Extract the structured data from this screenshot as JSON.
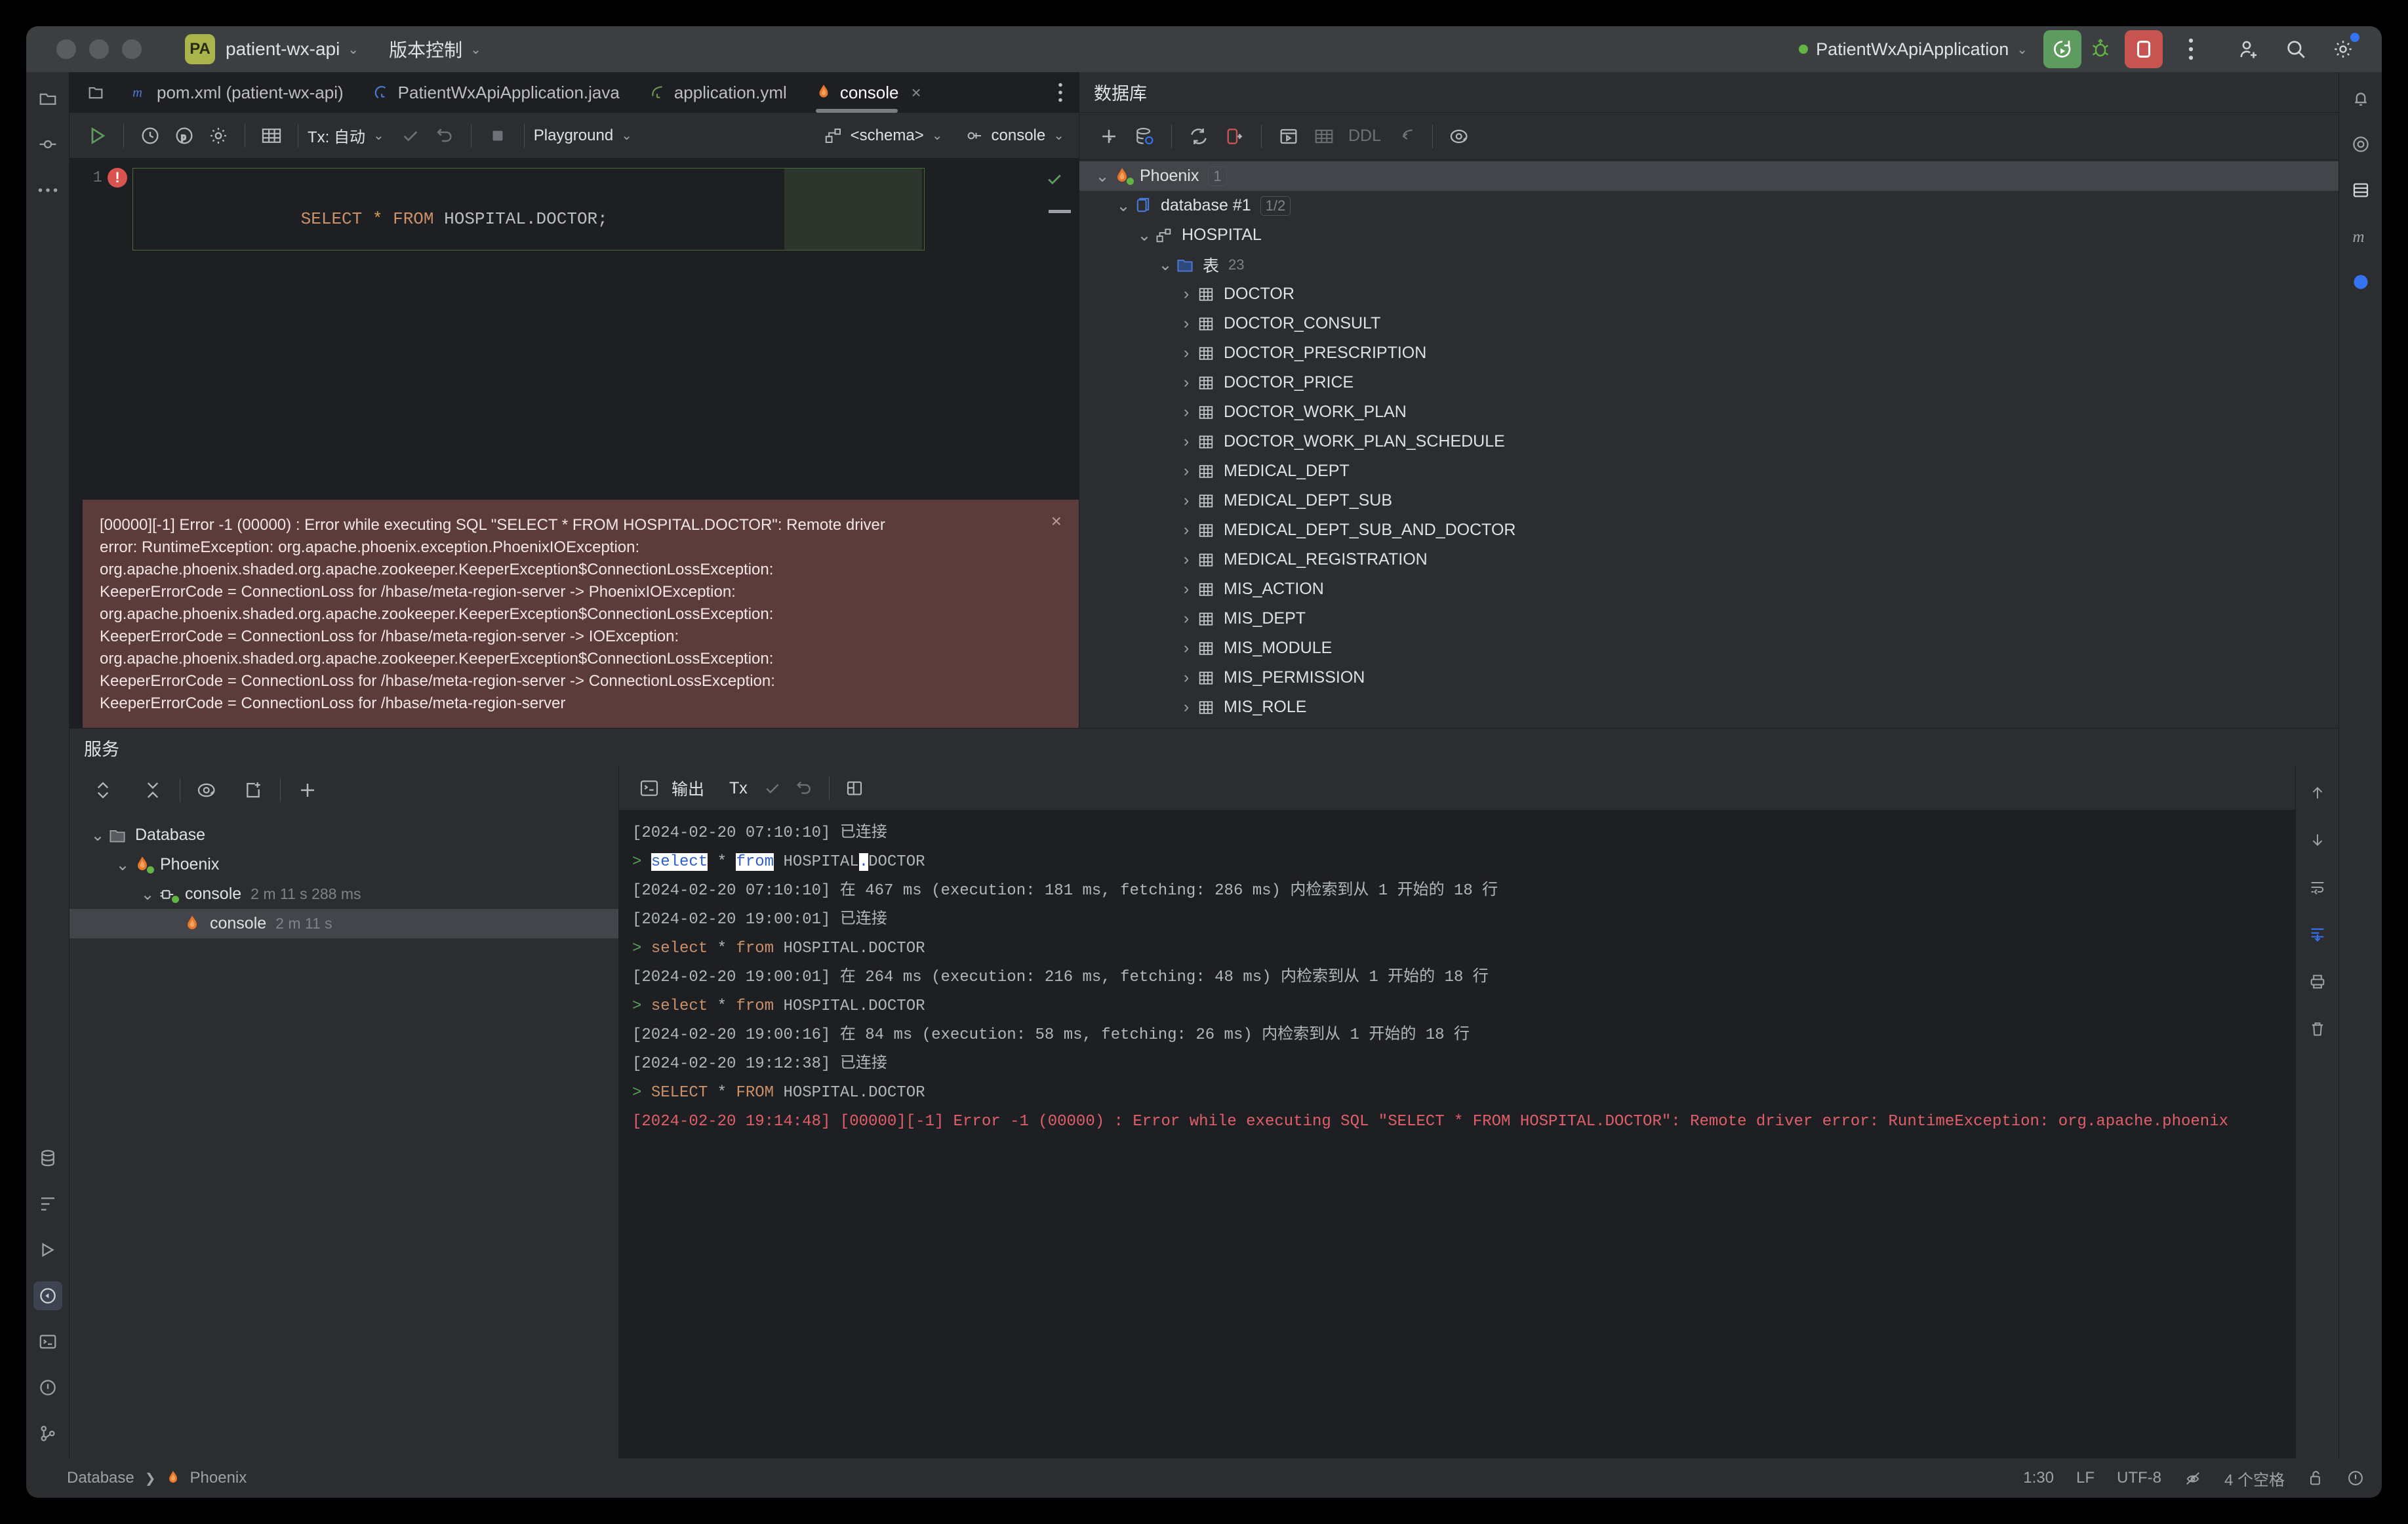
{
  "titlebar": {
    "project_badge": "PA",
    "project_name": "patient-wx-api",
    "vcs_label": "版本控制",
    "run_config": "PatientWxApiApplication",
    "chevron": "⌄"
  },
  "editor_tabs": [
    {
      "label": "pom.xml (patient-wx-api)",
      "icon": "maven-m-icon",
      "active": false
    },
    {
      "label": "PatientWxApiApplication.java",
      "icon": "spring-boot-icon",
      "active": false
    },
    {
      "label": "application.yml",
      "icon": "spring-leaf-icon",
      "active": false
    },
    {
      "label": "console",
      "icon": "phoenix-flame-icon",
      "active": true,
      "closable": true
    }
  ],
  "sql_toolbar": {
    "run_label": "run-icon",
    "tx_label": "Tx: 自动",
    "playground_label": "Playground",
    "schema_label": "<schema>",
    "session_label": "console",
    "chevron": "⌄"
  },
  "editor": {
    "line_number": "1",
    "code_tokens": [
      {
        "text": "SELECT",
        "cls": "kw"
      },
      {
        "text": " ",
        "cls": "id"
      },
      {
        "text": "*",
        "cls": "op"
      },
      {
        "text": " ",
        "cls": "id"
      },
      {
        "text": "FROM",
        "cls": "kw"
      },
      {
        "text": " HOSPITAL.DOCTOR;",
        "cls": "id"
      }
    ],
    "code_plain": "SELECT * FROM HOSPITAL.DOCTOR;"
  },
  "error_panel": {
    "close": "×",
    "lines": [
      "[00000][-1] Error -1 (00000) : Error while executing SQL \"SELECT * FROM HOSPITAL.DOCTOR\": Remote driver",
      "error: RuntimeException: org.apache.phoenix.exception.PhoenixIOException:",
      "org.apache.phoenix.shaded.org.apache.zookeeper.KeeperException$ConnectionLossException:",
      "KeeperErrorCode = ConnectionLoss for /hbase/meta-region-server -> PhoenixIOException:",
      "org.apache.phoenix.shaded.org.apache.zookeeper.KeeperException$ConnectionLossException:",
      "KeeperErrorCode = ConnectionLoss for /hbase/meta-region-server -> IOException:",
      "org.apache.phoenix.shaded.org.apache.zookeeper.KeeperException$ConnectionLossException:",
      "KeeperErrorCode = ConnectionLoss for /hbase/meta-region-server -> ConnectionLossException:",
      "KeeperErrorCode = ConnectionLoss for /hbase/meta-region-server"
    ]
  },
  "database_panel": {
    "title": "数据库",
    "toolbar_icons": [
      "plus-icon",
      "database-refresh-icon",
      "sync-icon",
      "stop-session-icon",
      "open-console-icon",
      "table-editor-icon",
      "ddl-icon",
      "jump-to-editor-icon",
      "eye-icon"
    ],
    "ddl_label": "DDL",
    "tree": [
      {
        "label": "Phoenix",
        "badge": "1",
        "depth": 0,
        "arrow": "⌄",
        "icon": "phoenix-flame-icon",
        "selected": true
      },
      {
        "label": "database #1",
        "badge": "1/2",
        "depth": 1,
        "arrow": "⌄",
        "icon": "database-icon",
        "selected": false
      },
      {
        "label": "HOSPITAL",
        "badge": "",
        "depth": 2,
        "arrow": "⌄",
        "icon": "schema-icon",
        "selected": false
      },
      {
        "label": "表",
        "badge": "23",
        "depth": 3,
        "arrow": "⌄",
        "icon": "folder-icon",
        "selected": false,
        "badge_plain": true
      },
      {
        "label": "DOCTOR",
        "badge": "",
        "depth": 4,
        "arrow": "›",
        "icon": "table-icon",
        "selected": false
      },
      {
        "label": "DOCTOR_CONSULT",
        "badge": "",
        "depth": 4,
        "arrow": "›",
        "icon": "table-icon",
        "selected": false
      },
      {
        "label": "DOCTOR_PRESCRIPTION",
        "badge": "",
        "depth": 4,
        "arrow": "›",
        "icon": "table-icon",
        "selected": false
      },
      {
        "label": "DOCTOR_PRICE",
        "badge": "",
        "depth": 4,
        "arrow": "›",
        "icon": "table-icon",
        "selected": false
      },
      {
        "label": "DOCTOR_WORK_PLAN",
        "badge": "",
        "depth": 4,
        "arrow": "›",
        "icon": "table-icon",
        "selected": false
      },
      {
        "label": "DOCTOR_WORK_PLAN_SCHEDULE",
        "badge": "",
        "depth": 4,
        "arrow": "›",
        "icon": "table-icon",
        "selected": false
      },
      {
        "label": "MEDICAL_DEPT",
        "badge": "",
        "depth": 4,
        "arrow": "›",
        "icon": "table-icon",
        "selected": false
      },
      {
        "label": "MEDICAL_DEPT_SUB",
        "badge": "",
        "depth": 4,
        "arrow": "›",
        "icon": "table-icon",
        "selected": false
      },
      {
        "label": "MEDICAL_DEPT_SUB_AND_DOCTOR",
        "badge": "",
        "depth": 4,
        "arrow": "›",
        "icon": "table-icon",
        "selected": false
      },
      {
        "label": "MEDICAL_REGISTRATION",
        "badge": "",
        "depth": 4,
        "arrow": "›",
        "icon": "table-icon",
        "selected": false
      },
      {
        "label": "MIS_ACTION",
        "badge": "",
        "depth": 4,
        "arrow": "›",
        "icon": "table-icon",
        "selected": false
      },
      {
        "label": "MIS_DEPT",
        "badge": "",
        "depth": 4,
        "arrow": "›",
        "icon": "table-icon",
        "selected": false
      },
      {
        "label": "MIS_MODULE",
        "badge": "",
        "depth": 4,
        "arrow": "›",
        "icon": "table-icon",
        "selected": false
      },
      {
        "label": "MIS_PERMISSION",
        "badge": "",
        "depth": 4,
        "arrow": "›",
        "icon": "table-icon",
        "selected": false
      },
      {
        "label": "MIS_ROLE",
        "badge": "",
        "depth": 4,
        "arrow": "›",
        "icon": "table-icon",
        "selected": false
      }
    ]
  },
  "services_panel": {
    "title": "服务",
    "tree": [
      {
        "label": "Database",
        "depth": 0,
        "arrow": "⌄",
        "icon": "folder-icon",
        "duration": "",
        "selected": false
      },
      {
        "label": "Phoenix",
        "depth": 1,
        "arrow": "⌄",
        "icon": "phoenix-flame-icon",
        "duration": "",
        "selected": false
      },
      {
        "label": "console",
        "depth": 2,
        "arrow": "⌄",
        "icon": "connection-plug-icon",
        "duration": "2 m 11 s 288 ms",
        "selected": false
      },
      {
        "label": "console",
        "depth": 3,
        "arrow": "",
        "icon": "phoenix-flame-icon",
        "duration": "2 m 11 s",
        "selected": true
      }
    ]
  },
  "output": {
    "tab_label": "输出",
    "tx_label": "Tx",
    "lines": [
      {
        "type": "info",
        "segments": [
          {
            "t": "[2024-02-20 07:10:10] 已连接",
            "c": "plain"
          }
        ]
      },
      {
        "type": "query_hl",
        "segments": [
          {
            "t": "> ",
            "c": "gt"
          },
          {
            "t": "select",
            "c": "hl"
          },
          {
            "t": " * ",
            "c": "plain"
          },
          {
            "t": "from",
            "c": "hl"
          },
          {
            "t": " HOSPITAL",
            "c": "plain"
          },
          {
            "t": ".",
            "c": "hl2"
          },
          {
            "t": "DOCTOR",
            "c": "plain"
          }
        ]
      },
      {
        "type": "info",
        "segments": [
          {
            "t": "[2024-02-20 07:10:10] 在 467 ms (execution: 181 ms, fetching: 286 ms) 内检索到从 1 开始的 18 行",
            "c": "plain"
          }
        ]
      },
      {
        "type": "info",
        "segments": [
          {
            "t": "[2024-02-20 19:00:01] 已连接",
            "c": "plain"
          }
        ]
      },
      {
        "type": "query",
        "segments": [
          {
            "t": "> ",
            "c": "gt"
          },
          {
            "t": "select",
            "c": "k"
          },
          {
            "t": " * ",
            "c": "plain"
          },
          {
            "t": "from",
            "c": "k"
          },
          {
            "t": " HOSPITAL.DOCTOR",
            "c": "plain"
          }
        ]
      },
      {
        "type": "info",
        "segments": [
          {
            "t": "[2024-02-20 19:00:01] 在 264 ms (execution: 216 ms, fetching: 48 ms) 内检索到从 1 开始的 18 行",
            "c": "plain"
          }
        ]
      },
      {
        "type": "query",
        "segments": [
          {
            "t": "> ",
            "c": "gt"
          },
          {
            "t": "select",
            "c": "k"
          },
          {
            "t": " * ",
            "c": "plain"
          },
          {
            "t": "from",
            "c": "k"
          },
          {
            "t": " HOSPITAL.DOCTOR",
            "c": "plain"
          }
        ]
      },
      {
        "type": "info",
        "segments": [
          {
            "t": "[2024-02-20 19:00:16] 在 84 ms (execution: 58 ms, fetching: 26 ms) 内检索到从 1 开始的 18 行",
            "c": "plain"
          }
        ]
      },
      {
        "type": "info",
        "segments": [
          {
            "t": "[2024-02-20 19:12:38] 已连接",
            "c": "plain"
          }
        ]
      },
      {
        "type": "query",
        "segments": [
          {
            "t": "> ",
            "c": "gt"
          },
          {
            "t": "SELECT",
            "c": "k"
          },
          {
            "t": " * ",
            "c": "plain"
          },
          {
            "t": "FROM",
            "c": "k"
          },
          {
            "t": " HOSPITAL.DOCTOR",
            "c": "plain"
          }
        ]
      },
      {
        "type": "error",
        "segments": [
          {
            "t": "[2024-02-20 19:14:48] [00000][-1] Error -1 (00000) : Error while executing SQL \"SELECT * FROM HOSPITAL.DOCTOR\": Remote driver error: RuntimeException: org.apache.phoenix",
            "c": "err"
          }
        ]
      }
    ]
  },
  "status_bar": {
    "breadcrumb_root": "Database",
    "breadcrumb_sep": "❯",
    "breadcrumb_leaf": "Phoenix",
    "caret_position": "1:30",
    "line_separator": "LF",
    "encoding": "UTF-8",
    "indent": "4 个空格",
    "icons": [
      "no-read-only-icon",
      "lock-open-icon",
      "notifications-icon"
    ]
  }
}
